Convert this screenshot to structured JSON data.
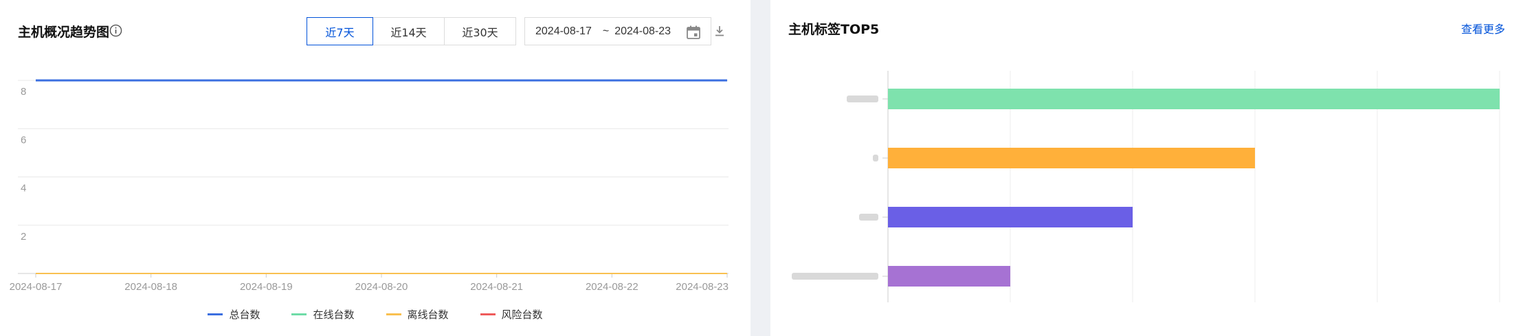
{
  "left_panel": {
    "title": "主机概况趋势图",
    "range_buttons": [
      {
        "label": "近7天",
        "active": true
      },
      {
        "label": "近14天",
        "active": false
      },
      {
        "label": "近30天",
        "active": false
      }
    ],
    "date_range": {
      "start": "2024-08-17",
      "separator": "~",
      "end": "2024-08-23"
    },
    "icons": {
      "info": "info-icon",
      "calendar": "calendar-icon",
      "download": "download-icon"
    },
    "legend": [
      {
        "label": "总台数",
        "color": "#3b6fe0"
      },
      {
        "label": "在线台数",
        "color": "#6fdca7"
      },
      {
        "label": "离线台数",
        "color": "#f9c050"
      },
      {
        "label": "风险台数",
        "color": "#ef5b5b"
      }
    ]
  },
  "right_panel": {
    "title": "主机标签TOP5",
    "more_link": "查看更多"
  },
  "chart_data": [
    {
      "type": "line",
      "title": "主机概况趋势图",
      "x": [
        "2024-08-17",
        "2024-08-18",
        "2024-08-19",
        "2024-08-20",
        "2024-08-21",
        "2024-08-22",
        "2024-08-23"
      ],
      "y_ticks": [
        "2",
        "4",
        "6",
        "8"
      ],
      "ylim": [
        0,
        8
      ],
      "grid": true,
      "series": [
        {
          "name": "总台数",
          "color": "#3b6fe0",
          "values": [
            8,
            8,
            8,
            8,
            8,
            8,
            8
          ]
        },
        {
          "name": "在线台数",
          "color": "#6fdca7",
          "values": [
            0,
            0,
            0,
            0,
            0,
            0,
            0
          ]
        },
        {
          "name": "离线台数",
          "color": "#f9c050",
          "values": [
            0,
            0,
            0,
            0,
            0,
            0,
            0
          ]
        },
        {
          "name": "风险台数",
          "color": "#ef5b5b",
          "values": [
            0,
            0,
            0,
            0,
            0,
            0,
            0
          ]
        }
      ],
      "legend_position": "bottom"
    },
    {
      "type": "bar",
      "orientation": "horizontal",
      "title": "主机标签TOP5",
      "grid": true,
      "categories_note": "category labels are blurred in the screenshot",
      "bars": [
        {
          "value": 5,
          "color": "#7ee2ad"
        },
        {
          "value": 3,
          "color": "#ffb03a"
        },
        {
          "value": 2,
          "color": "#6a5fe6"
        },
        {
          "value": 1,
          "color": "#a672d3"
        }
      ],
      "xlim": [
        0,
        5
      ]
    }
  ]
}
